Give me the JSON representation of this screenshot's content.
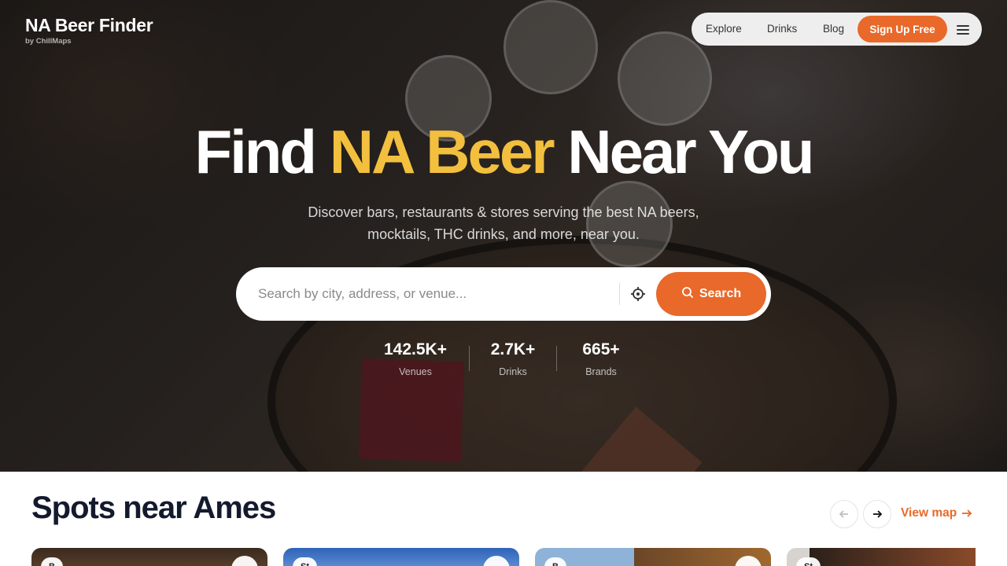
{
  "header": {
    "logo_title": "NA Beer Finder",
    "logo_subtitle": "by ChillMaps",
    "nav": [
      {
        "label": "Explore"
      },
      {
        "label": "Drinks"
      },
      {
        "label": "Blog"
      }
    ],
    "signup_label": "Sign Up Free",
    "menu_icon": "hamburger-menu-icon"
  },
  "hero": {
    "title_part1": "Find ",
    "title_accent": "NA Beer",
    "title_part2": " Near You",
    "subtitle": "Discover bars, restaurants & stores serving the best NA beers, mocktails, THC drinks, and more, near you."
  },
  "search": {
    "placeholder": "Search by city, address, or venue...",
    "value": "",
    "locate_icon": "crosshair-locate-icon",
    "button_label": "Search",
    "button_icon": "search-icon"
  },
  "stats": [
    {
      "value": "142.5K+",
      "label": "Venues"
    },
    {
      "value": "2.7K+",
      "label": "Drinks"
    },
    {
      "value": "665+",
      "label": "Brands"
    }
  ],
  "spots": {
    "title": "Spots near Ames",
    "view_map_label": "View map",
    "cards": [
      {
        "tag": "B"
      },
      {
        "tag": "St"
      },
      {
        "tag": "B"
      },
      {
        "tag": "St"
      }
    ]
  },
  "colors": {
    "accent_orange": "#e8692a",
    "accent_yellow": "#f2bf3f",
    "title_navy": "#141a2e"
  }
}
